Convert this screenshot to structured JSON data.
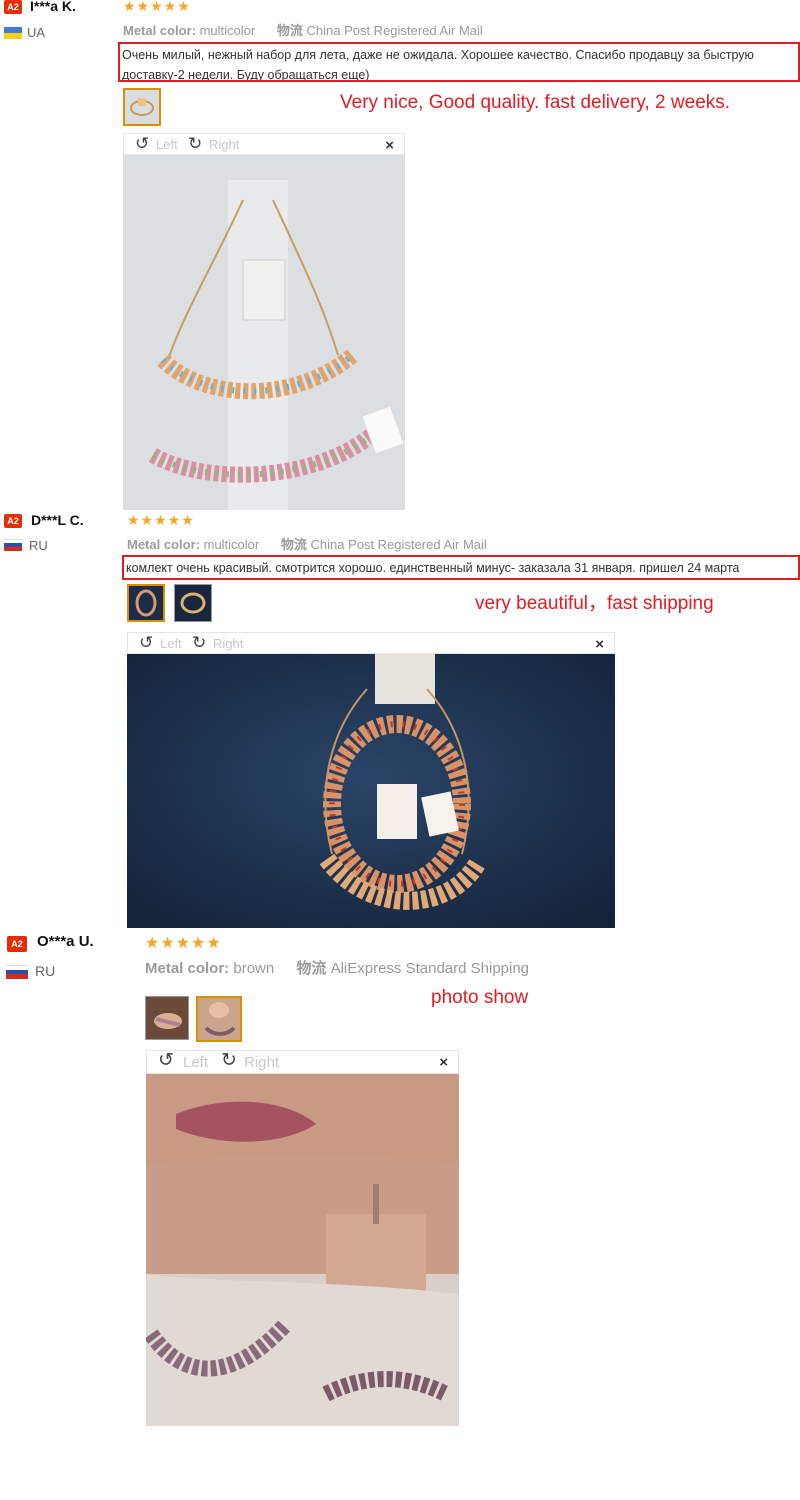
{
  "reviews": [
    {
      "badge": "A2",
      "username": "I***a K.",
      "country": "UA",
      "stars": "★★★★★",
      "meta_color_label": "Metal color:",
      "meta_color_value": "multicolor",
      "meta_shipping_label": "物流",
      "meta_shipping_value": "China Post Registered Air Mail",
      "feedback": "Очень милый, нежный набор для лета, даже не ожидала. Хорошее качество. Спасибо продавцу за быструю доставку-2 недели. Буду обращаться еще)",
      "note": "Very nice, Good quality. fast delivery, 2 weeks.",
      "viewer": {
        "left": "Left",
        "right": "Right",
        "close": "×"
      }
    },
    {
      "badge": "A2",
      "username": "D***L C.",
      "country": "RU",
      "stars": "★★★★★",
      "meta_color_label": "Metal color:",
      "meta_color_value": "multicolor",
      "meta_shipping_label": "物流",
      "meta_shipping_value": "China Post Registered Air Mail",
      "feedback": "комлект очень красивый. смотрится хорошо. единственный минус- заказала 31 января. пришел 24 марта",
      "note": "very beautiful，fast shipping",
      "viewer": {
        "left": "Left",
        "right": "Right",
        "close": "×"
      }
    },
    {
      "badge": "A2",
      "username": "O***a U.",
      "country": "RU",
      "stars": "★★★★★",
      "meta_color_label": "Metal color:",
      "meta_color_value": "brown",
      "meta_shipping_label": "物流",
      "meta_shipping_value": "AliExpress Standard Shipping",
      "note": "photo show",
      "viewer": {
        "left": "Left",
        "right": "Right",
        "close": "×"
      }
    }
  ],
  "colors": {
    "accent_red": "#e31b23",
    "star": "#f6a623",
    "badge": "#e62e04"
  }
}
